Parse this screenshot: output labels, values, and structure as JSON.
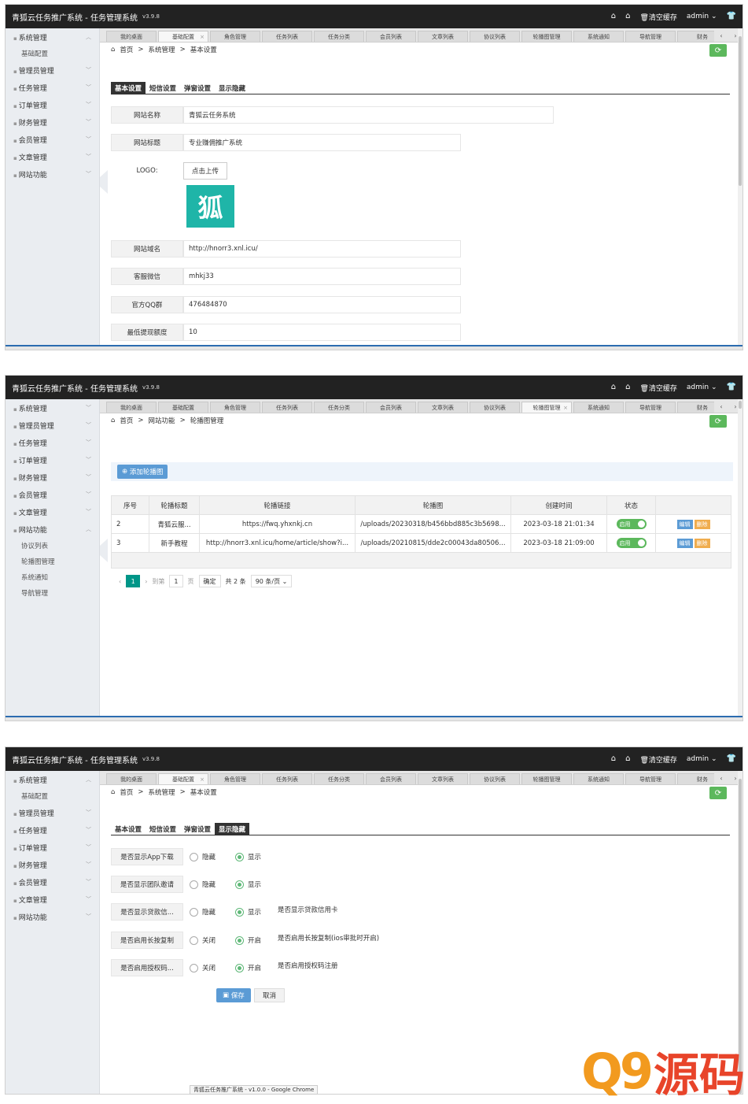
{
  "app": {
    "title": "青狐云任务推广系统 - 任务管理系统",
    "version": "v3.9.8",
    "clear_cache": "清空缓存",
    "user": "admin"
  },
  "tabs": [
    "我的桌面",
    "基础配置",
    "角色管理",
    "任务列表",
    "任务分类",
    "会员列表",
    "文章列表",
    "协议列表",
    "轮播图管理",
    "系统通知",
    "导航管理",
    "财务"
  ],
  "sidebar": {
    "items": [
      "系统管理",
      "管理员管理",
      "任务管理",
      "订单管理",
      "财务管理",
      "会员管理",
      "文章管理",
      "网站功能"
    ],
    "sub_system": [
      "基础配置"
    ],
    "sub_site": [
      "协议列表",
      "轮播图管理",
      "系统通知",
      "导航管理"
    ]
  },
  "crumbs": {
    "home": "首页",
    "sys": "系统管理",
    "basic": "基本设置",
    "site": "网站功能",
    "banner": "轮播图管理",
    "sep": ">"
  },
  "subtabs": [
    "基本设置",
    "短信设置",
    "弹窗设置",
    "显示隐藏"
  ],
  "basic_form": {
    "site_name_label": "网站名称",
    "site_name": "青狐云任务系统",
    "site_title_label": "网站标题",
    "site_title": "专业赚佣推广系统",
    "logo_label": "LOGO:",
    "upload": "点击上传",
    "logo_glyph": "狐",
    "domain_label": "网站域名",
    "domain": "http://hnorr3.xnl.icu/",
    "wechat_label": "客服微信",
    "wechat": "mhkj33",
    "qq_label": "官方QQ群",
    "qq": "476484870",
    "min_withdraw_label": "最低提现额度",
    "min_withdraw": "10"
  },
  "banner": {
    "add": "添加轮播图",
    "headers": [
      "序号",
      "轮播标题",
      "轮播链接",
      "轮播图",
      "创建时间",
      "状态",
      ""
    ],
    "rows": [
      {
        "id": "2",
        "title": "青狐云服...",
        "link": "https://fwq.yhxnkj.cn",
        "img": "/uploads/20230318/b456bbd885c3b5698...",
        "time": "2023-03-18 21:01:34",
        "status": "启用"
      },
      {
        "id": "3",
        "title": "新手教程",
        "link": "http://hnorr3.xnl.icu/home/article/show?i...",
        "img": "/uploads/20210815/dde2c00043da80506...",
        "time": "2023-03-18 21:09:00",
        "status": "启用"
      }
    ],
    "edit": "编辑",
    "del": "删除",
    "pager": {
      "current": "1",
      "goto": "到第",
      "page_input": "1",
      "page": "页",
      "ok": "确定",
      "total": "共 2 条",
      "size": "90 条/页"
    }
  },
  "display_form": {
    "rows": [
      {
        "label": "是否显示App下载",
        "off": "隐藏",
        "on": "显示",
        "hint": ""
      },
      {
        "label": "是否显示团队邀请",
        "off": "隐藏",
        "on": "显示",
        "hint": ""
      },
      {
        "label": "是否显示贷款信...",
        "off": "隐藏",
        "on": "显示",
        "hint": "是否显示贷款信用卡"
      },
      {
        "label": "是否启用长按复制",
        "off": "关闭",
        "on": "开启",
        "hint": "是否启用长按复制(ios审批时开启)"
      },
      {
        "label": "是否启用授权码...",
        "off": "关闭",
        "on": "开启",
        "hint": "是否启用授权码注册"
      }
    ],
    "save": "保存",
    "cancel": "取消"
  },
  "caption": "青狐云任务推广系统 - v1.0.0 - Google Chrome",
  "watermark": {
    "q": "Q9",
    "y": "源码"
  },
  "colors": {
    "accent_green": "#5cb85c",
    "primary_blue": "#5b9bd5",
    "brand_orange": "#f29a1f",
    "brand_red": "#e8442a",
    "teal": "#009688"
  }
}
